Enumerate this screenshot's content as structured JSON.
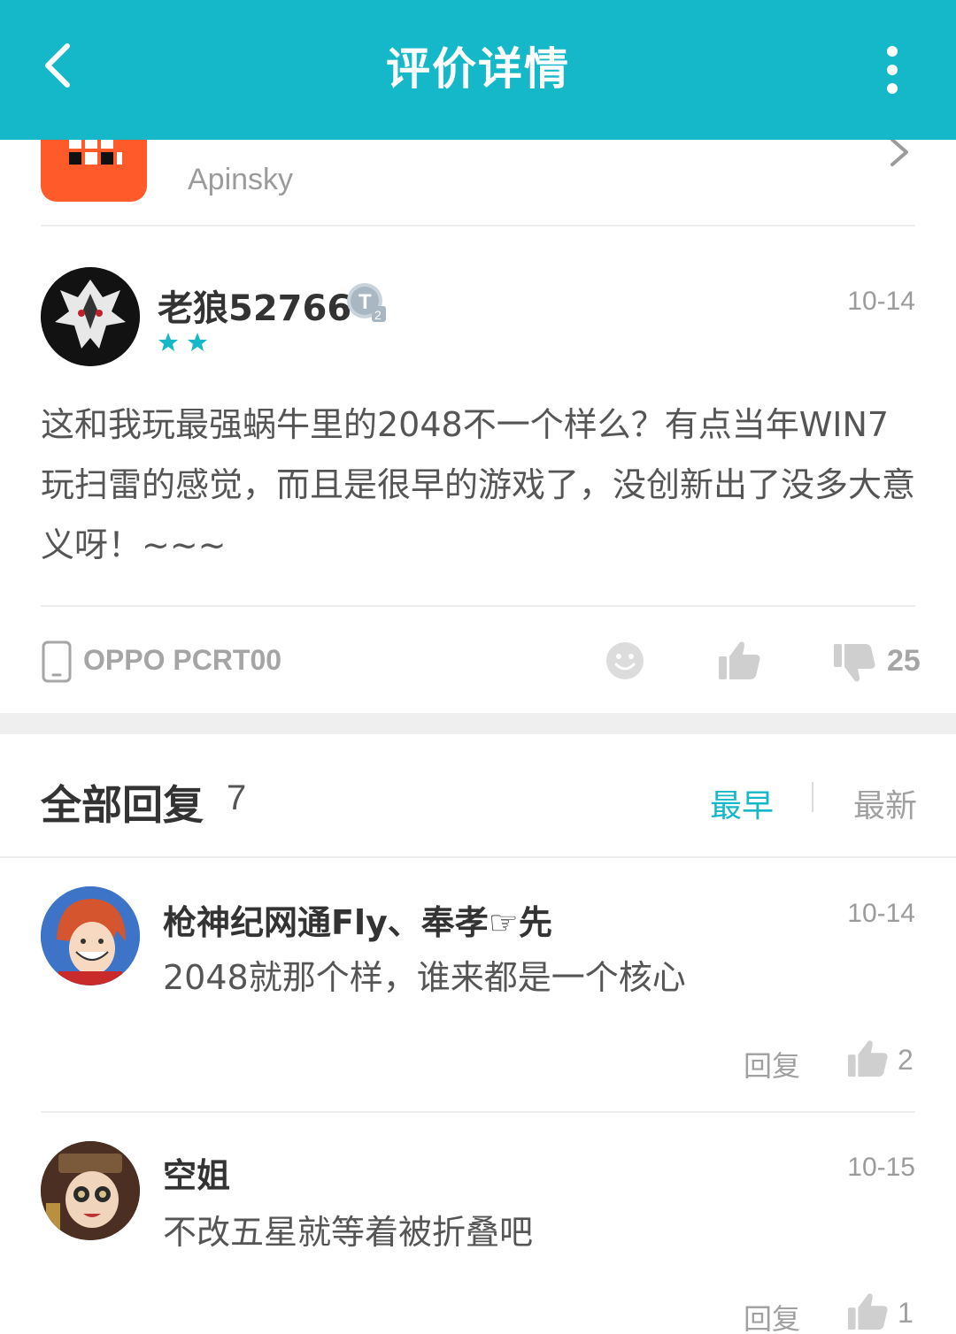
{
  "header": {
    "title": "评价详情",
    "back_icon": "chevron-left-icon",
    "more_icon": "more-vertical-icon",
    "color": "#15b8c8"
  },
  "app": {
    "developer": "Apinsky",
    "icon_color": "#ff5b2a"
  },
  "review": {
    "user_name": "老狼52766",
    "badge": "T2",
    "stars": 2,
    "date": "10-14",
    "content": "这和我玩最强蜗牛里的2048不一个样么？有点当年WIN7玩扫雷的感觉，而且是很早的游戏了，没创新出了没多大意义呀！~~~",
    "device": "OPPO PCRT00",
    "dislike_count": "25"
  },
  "replies_section": {
    "title": "全部回复",
    "count": "7",
    "sort_earliest": "最早",
    "sort_latest": "最新",
    "accent": "#15b8c8"
  },
  "replies": [
    {
      "name": "枪神纪网通Fly、奉孝☞先",
      "date": "10-14",
      "text": "2048就那个样，谁来都是一个核心",
      "reply_label": "回复",
      "likes": "2"
    },
    {
      "name": "空姐",
      "date": "10-15",
      "text": "不改五星就等着被折叠吧",
      "reply_label": "回复",
      "likes": "1"
    }
  ]
}
